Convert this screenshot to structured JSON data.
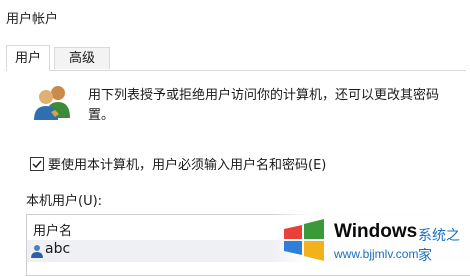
{
  "window": {
    "title": "用户帐户"
  },
  "tabs": [
    {
      "label": "用户",
      "active": true
    },
    {
      "label": "高级",
      "active": false
    }
  ],
  "description": {
    "line1": "用下列表授予或拒绝用户访问你的计算机，还可以更改其密码",
    "line2": "置。"
  },
  "require_login": {
    "label": "要使用本计算机，用户必须输入用户名和密码(E)",
    "checked": true
  },
  "local_users": {
    "section_label": "本机用户(U):",
    "column_header": "用户名",
    "rows": [
      {
        "name": "abc"
      }
    ]
  },
  "watermark": {
    "brand": "Windows",
    "brand_cn": "系统之家",
    "url": "www.bjjmlv.com"
  },
  "colors": {
    "accent_blue": "#1a6fc0",
    "row_highlight": "#eef0f3"
  }
}
